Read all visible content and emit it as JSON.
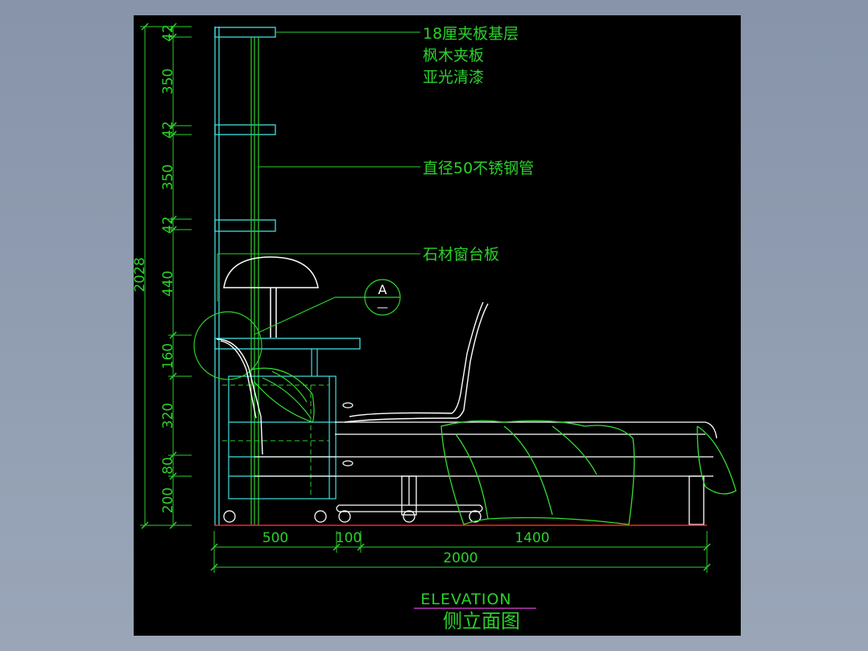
{
  "window": {
    "background_color": "#8d9bb0",
    "canvas_color": "#000000"
  },
  "drawing": {
    "title_en": "ELEVATION",
    "title_cn": "侧立面图",
    "notes": {
      "shelf_board": "18厘夹板基层",
      "shelf_veneer": "枫木夹板",
      "shelf_finish": "亚光清漆",
      "pipe": "直径50不锈钢管",
      "sill": "石材窗台板"
    },
    "section_marker": {
      "letter": "A",
      "sub": "—"
    },
    "vertical_dims": [
      "42",
      "350",
      "42",
      "350",
      "42",
      "440",
      "160",
      "320",
      "80",
      "200"
    ],
    "vertical_total": "2028",
    "horizontal_dims": [
      "500",
      "100",
      "1400"
    ],
    "horizontal_total": "2000",
    "colors": {
      "dimension": "#2bd12b",
      "outline_cyan": "#3fe0e0",
      "outline_white": "#ffffff",
      "bedding_green": "#33e033",
      "floor_red": "#ff2020",
      "magenta": "#e040e0"
    }
  }
}
